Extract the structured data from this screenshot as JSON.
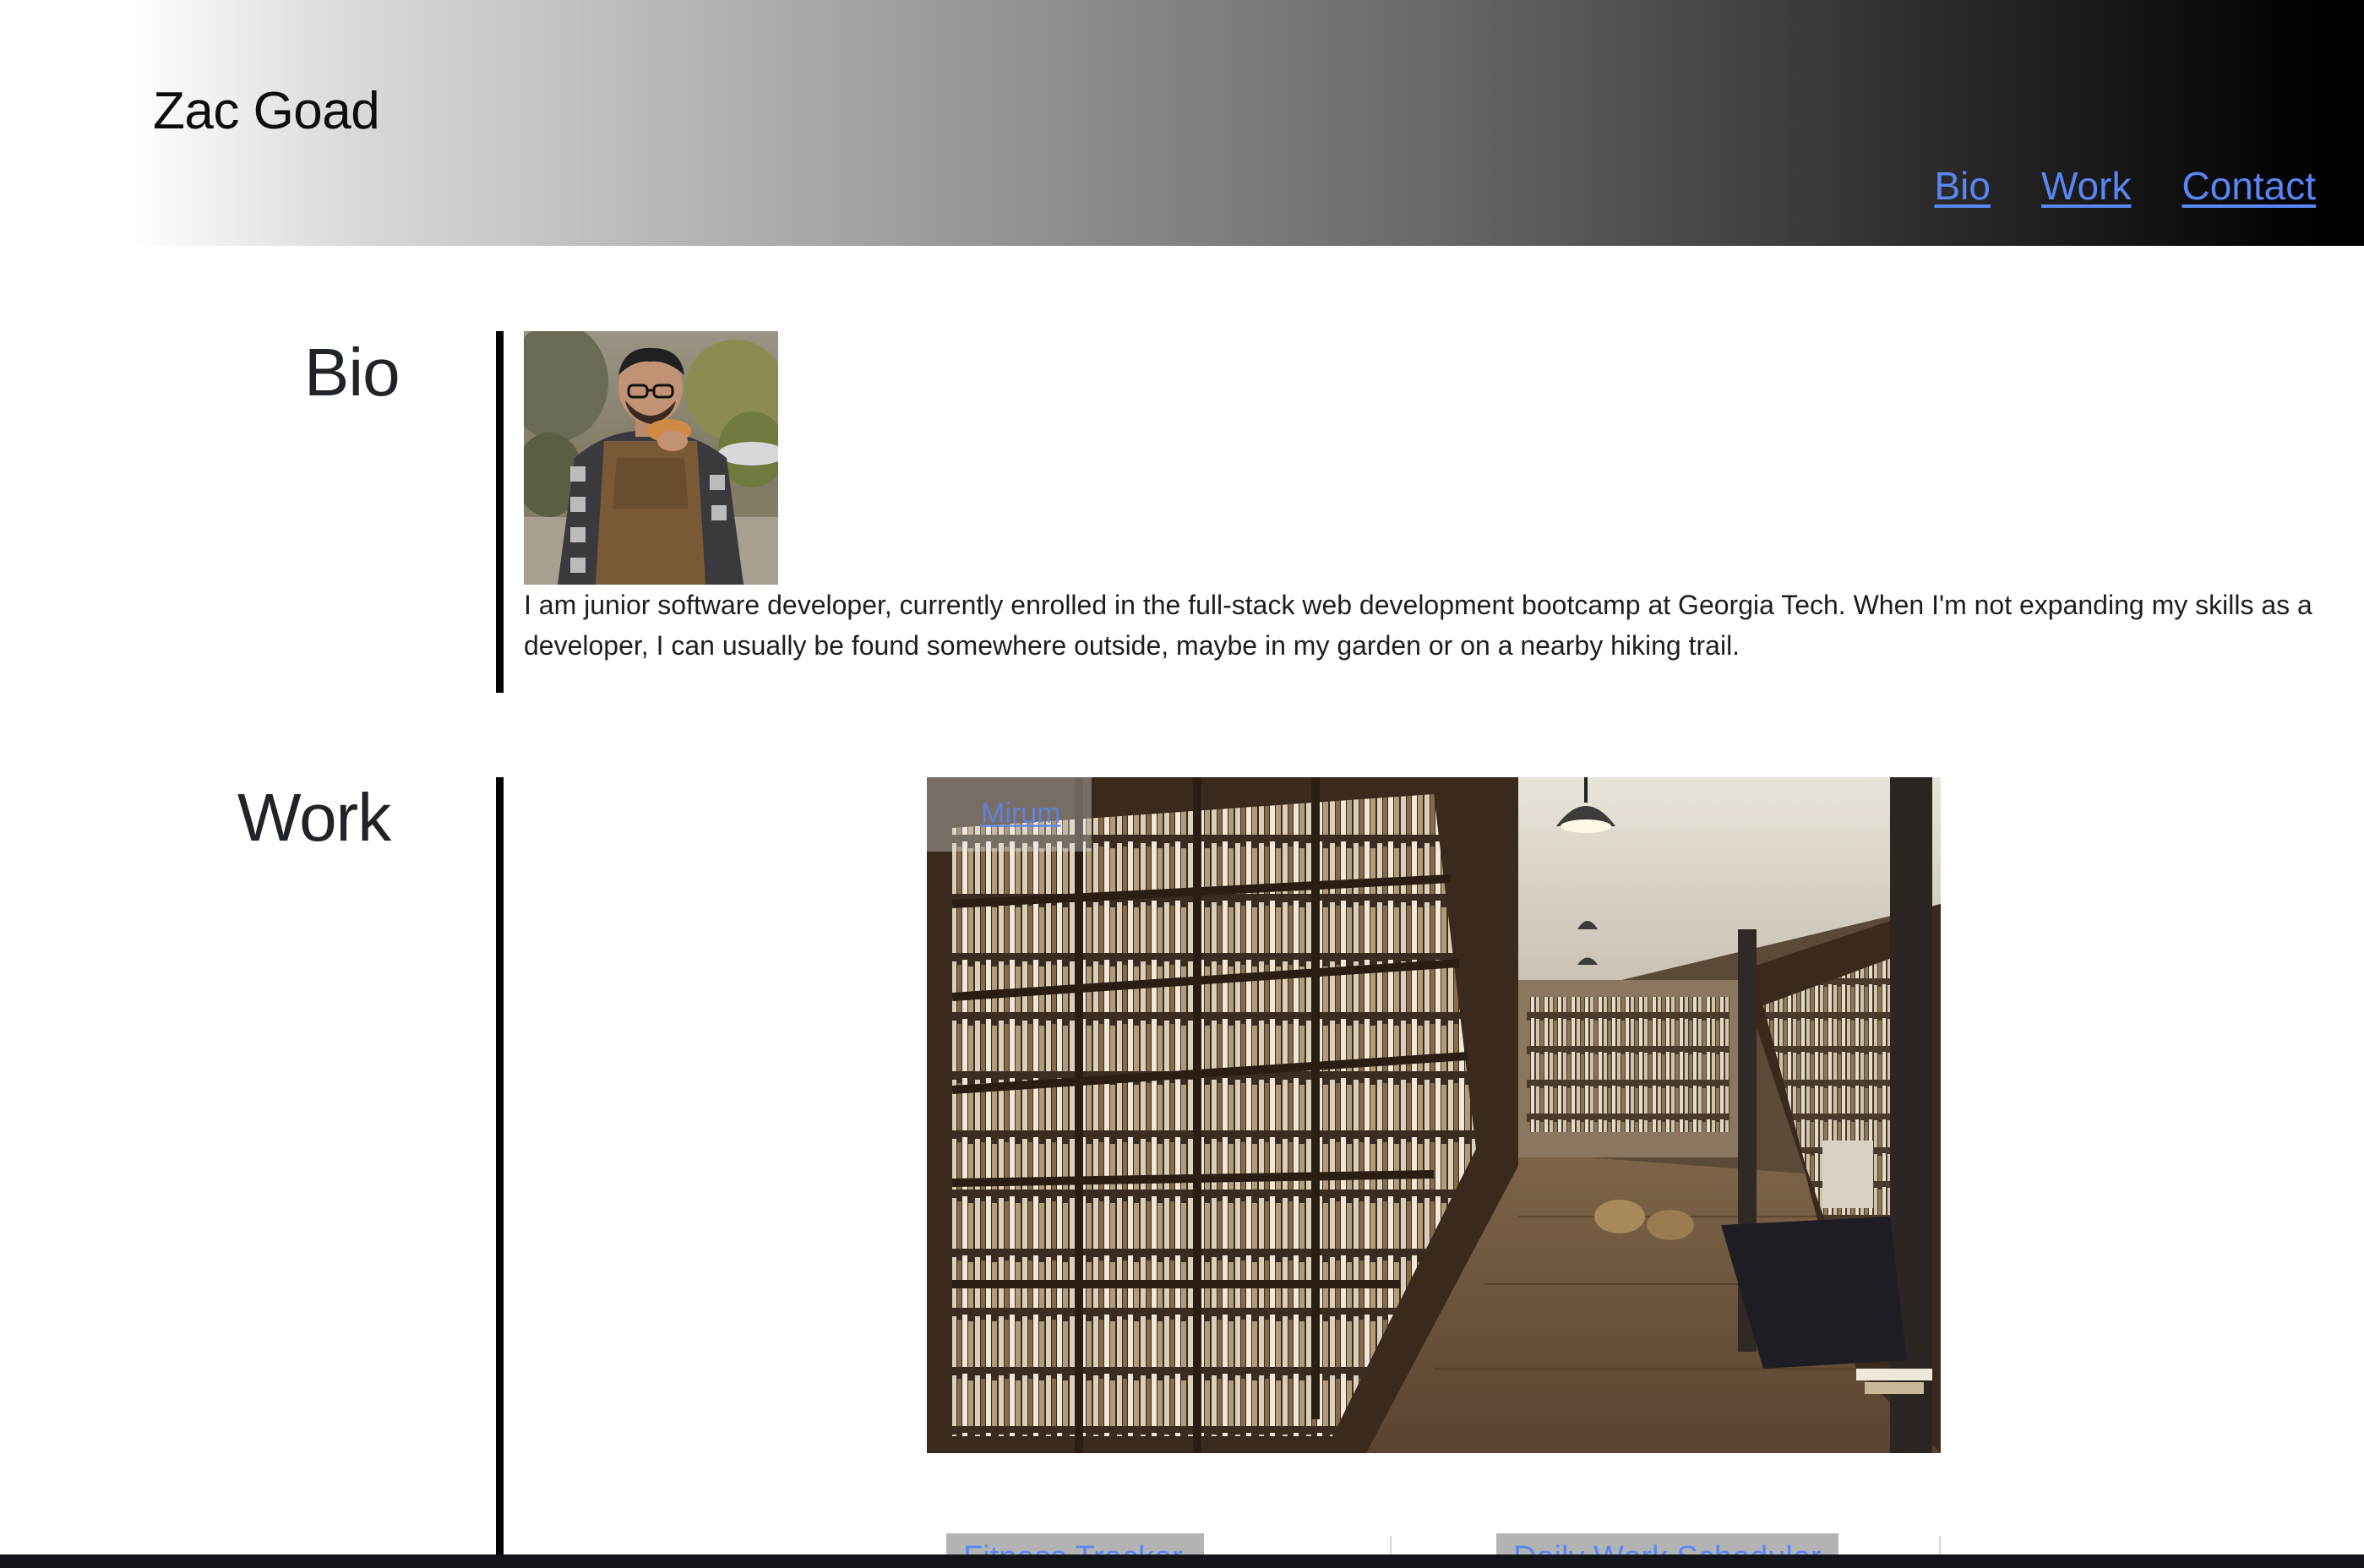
{
  "header": {
    "site_title": "Zac Goad",
    "nav": [
      {
        "label": "Bio"
      },
      {
        "label": "Work"
      },
      {
        "label": "Contact"
      }
    ]
  },
  "bio": {
    "heading": "Bio",
    "text": "I am junior software developer, currently enrolled in the full-stack web development bootcamp at Georgia Tech. When I'm not expanding my skills as a developer, I can usually be found somewhere outside, maybe in my garden or on a nearby hiking trail."
  },
  "work": {
    "heading": "Work",
    "featured_link": "Mirum",
    "projects": [
      {
        "label": "Fitness Tracker"
      },
      {
        "label": "Daily Work Scheduler"
      }
    ]
  },
  "colors": {
    "link": "#5a86f4",
    "rule": "#000000",
    "header_gradient_start": "#ffffff",
    "header_gradient_end": "#000000"
  }
}
